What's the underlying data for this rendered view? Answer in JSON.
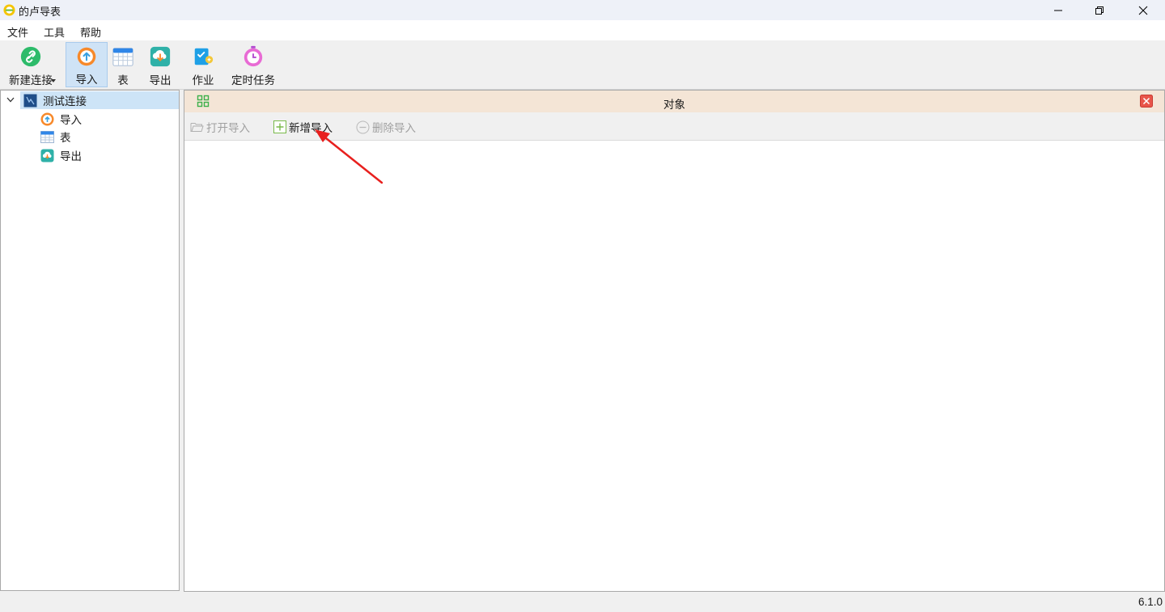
{
  "window": {
    "title": "的卢导表"
  },
  "menu": {
    "items": [
      "文件",
      "工具",
      "帮助"
    ]
  },
  "toolbar": {
    "new_connection": "新建连接",
    "import": "导入",
    "table": "表",
    "export": "导出",
    "job": "作业",
    "scheduled_task": "定时任务"
  },
  "tree": {
    "root": "测试连接",
    "children": [
      "导入",
      "表",
      "导出"
    ]
  },
  "panel": {
    "title": "对象",
    "open_import": "打开导入",
    "new_import": "新增导入",
    "delete_import": "删除导入"
  },
  "status": {
    "version": "6.1.0"
  },
  "colors": {
    "accent_selected": "#cde4f7",
    "panel_header": "#f4e5d6",
    "annotation_arrow": "#e8201e"
  }
}
